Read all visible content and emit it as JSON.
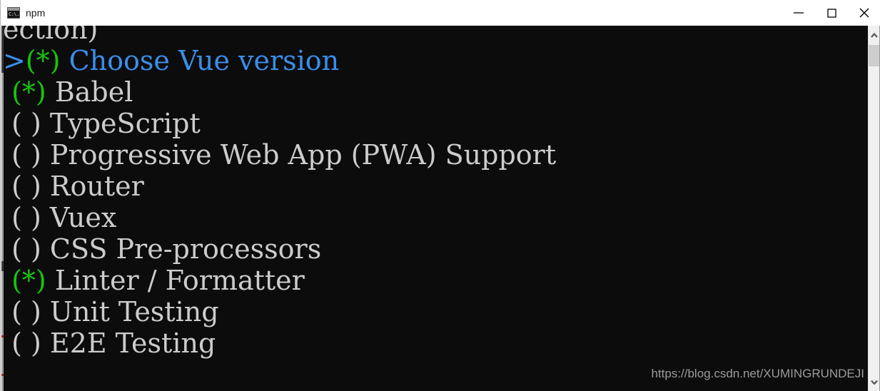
{
  "window": {
    "title": "npm",
    "icon": "cmd-console-icon",
    "icon_prompt_text": "C:\\.",
    "controls": {
      "minimize": "Minimize",
      "maximize": "Maximize",
      "close": "Close"
    }
  },
  "terminal": {
    "background_color": "#0c0c0c",
    "foreground_color": "#cccccc",
    "highlight_color": "#3b8eea",
    "marker_color": "#16c60c",
    "partial_top_line": "ection)",
    "cursor_symbol": ">",
    "checked_symbol": "(*)",
    "unchecked_symbol": "( )",
    "options": [
      {
        "pointer": ">",
        "checkbox": "(*)",
        "label": "Choose Vue version",
        "selected": true,
        "checked": true
      },
      {
        "pointer": " ",
        "checkbox": "(*)",
        "label": "Babel",
        "selected": false,
        "checked": true
      },
      {
        "pointer": " ",
        "checkbox": "( )",
        "label": "TypeScript",
        "selected": false,
        "checked": false
      },
      {
        "pointer": " ",
        "checkbox": "( )",
        "label": "Progressive Web App (PWA) Support",
        "selected": false,
        "checked": false
      },
      {
        "pointer": " ",
        "checkbox": "( )",
        "label": "Router",
        "selected": false,
        "checked": false
      },
      {
        "pointer": " ",
        "checkbox": "( )",
        "label": "Vuex",
        "selected": false,
        "checked": false
      },
      {
        "pointer": " ",
        "checkbox": "( )",
        "label": "CSS Pre-processors",
        "selected": false,
        "checked": false
      },
      {
        "pointer": " ",
        "checkbox": "(*)",
        "label": "Linter / Formatter",
        "selected": false,
        "checked": true
      },
      {
        "pointer": " ",
        "checkbox": "( )",
        "label": "Unit Testing",
        "selected": false,
        "checked": false
      },
      {
        "pointer": " ",
        "checkbox": "( )",
        "label": "E2E Testing",
        "selected": false,
        "checked": false
      }
    ]
  },
  "watermark": {
    "text": "https://blog.csdn.net/XUMINGRUNDEJI"
  },
  "scrollbar": {
    "up_arrow": "scroll-up",
    "down_arrow": "scroll-down",
    "thumb": "scroll-thumb"
  }
}
